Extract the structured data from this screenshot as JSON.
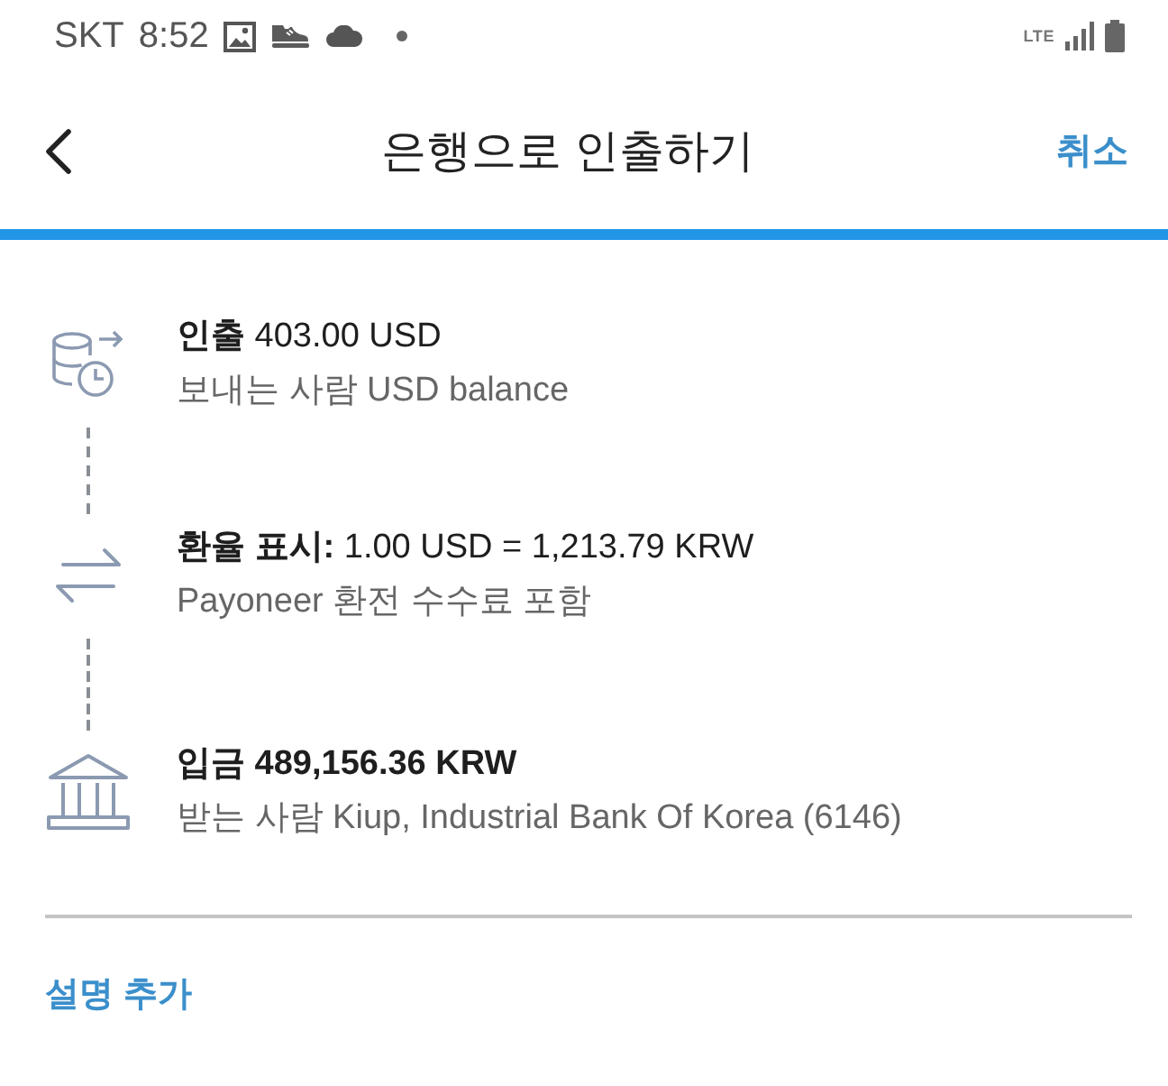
{
  "status_bar": {
    "carrier": "SKT",
    "time": "8:52",
    "network": "LTE"
  },
  "header": {
    "title": "은행으로 인출하기",
    "action": "취소"
  },
  "steps": [
    {
      "kind": "withdraw",
      "strong": false,
      "title": "**인출** 403.00 USD",
      "detail": "보내는 사람 USD balance"
    },
    {
      "kind": "exchange",
      "strong": false,
      "title": "**환율 표시:** 1.00 USD = 1,213.79 KRW",
      "detail": "Payoneer 환전 수수료 포함"
    },
    {
      "kind": "deposit",
      "strong": true,
      "title": "입금 489,156.36 KRW",
      "detail": "받는 사람 Kiup, Industrial Bank Of Korea (6146)"
    }
  ],
  "add_note": "설명 추가"
}
